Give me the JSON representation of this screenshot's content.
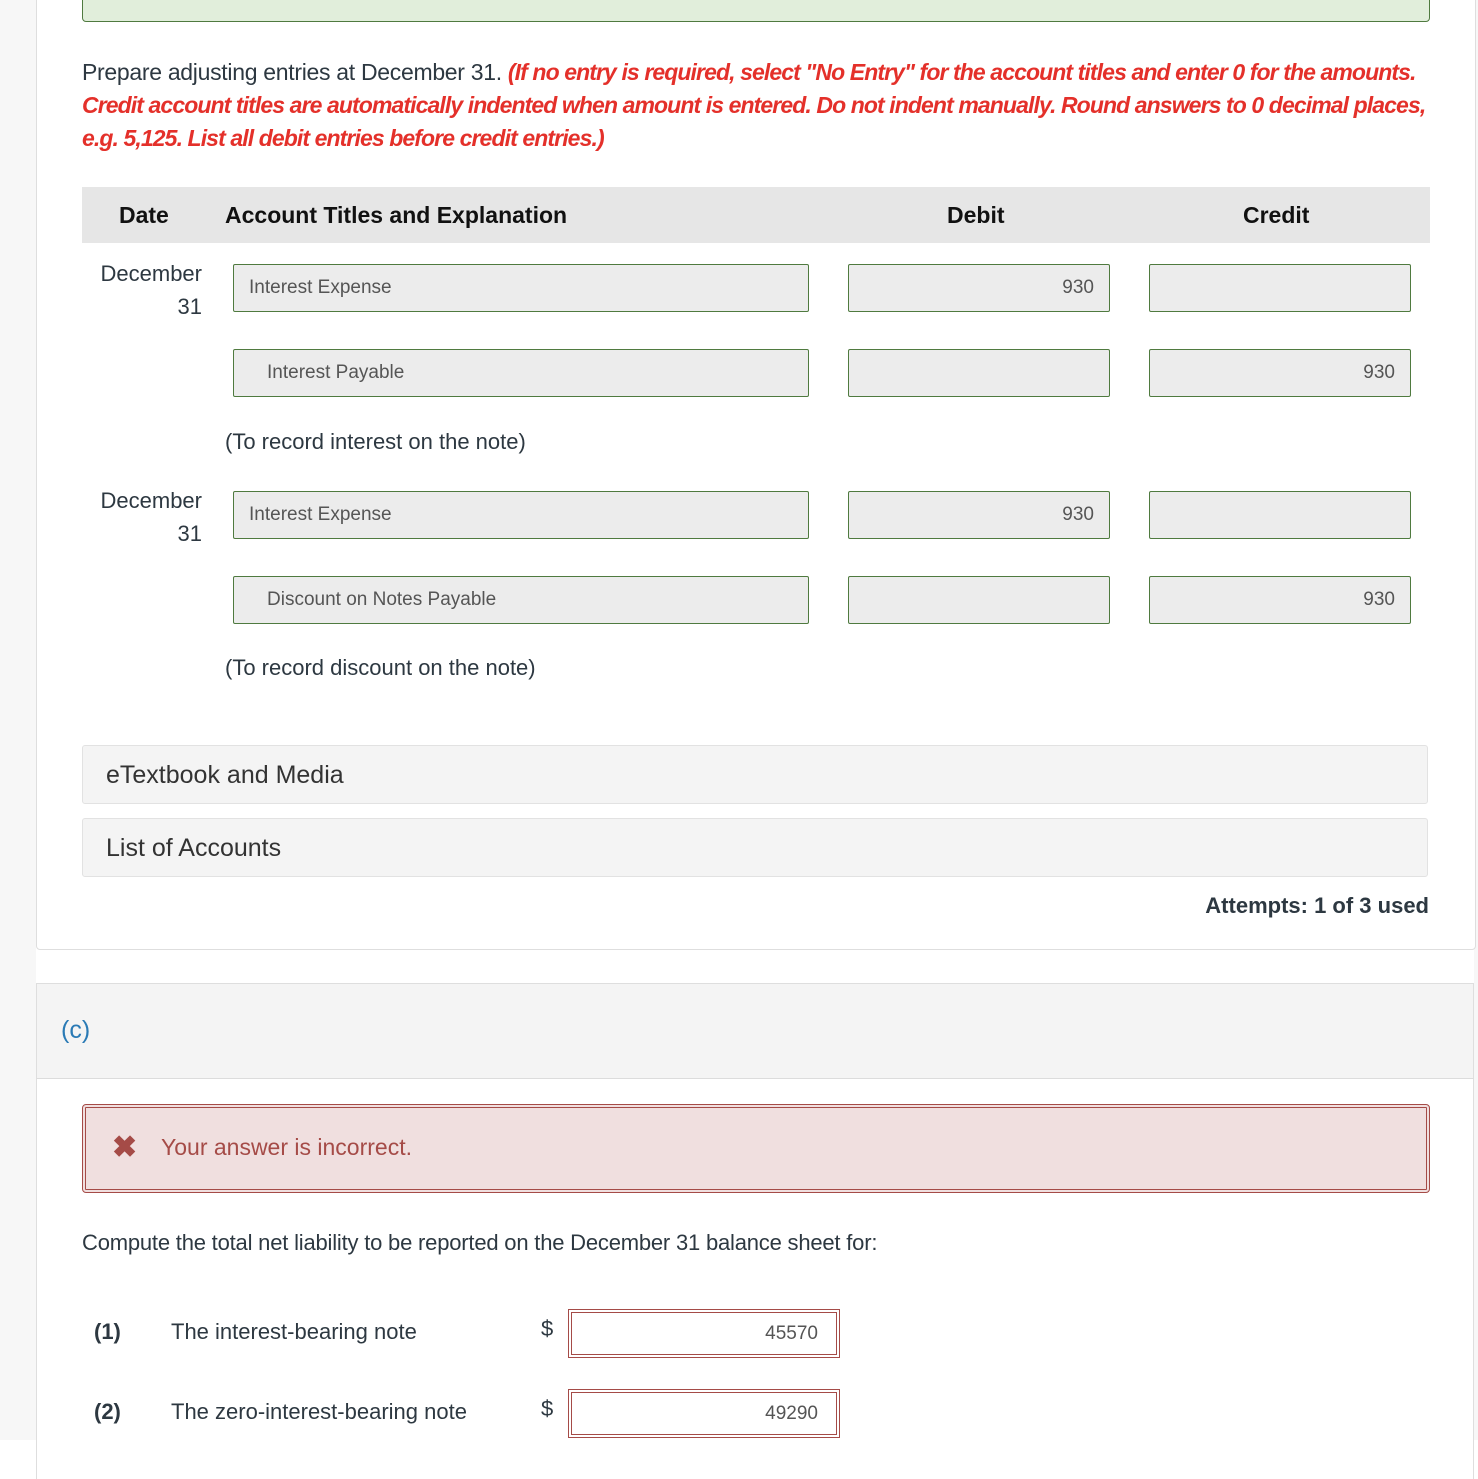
{
  "instructions": {
    "lead": "Prepare adjusting entries at December 31.",
    "note": "(If no entry is required, select \"No Entry\" for the account titles and enter 0 for the amounts. Credit account titles are automatically indented when amount is entered. Do not indent manually. Round answers to 0 decimal places, e.g. 5,125. List all debit entries before credit entries.)"
  },
  "table": {
    "headers": {
      "date": "Date",
      "account": "Account Titles and Explanation",
      "debit": "Debit",
      "credit": "Credit"
    },
    "entries": [
      {
        "date_line1": "December",
        "date_line2": "31",
        "rows": [
          {
            "account": "Interest Expense",
            "debit": "930",
            "credit": ""
          },
          {
            "account": "Interest Payable",
            "debit": "",
            "credit": "930"
          }
        ],
        "explanation": "(To record interest on the note)"
      },
      {
        "date_line1": "December",
        "date_line2": "31",
        "rows": [
          {
            "account": "Interest Expense",
            "debit": "930",
            "credit": ""
          },
          {
            "account": "Discount on Notes Payable",
            "debit": "",
            "credit": "930"
          }
        ],
        "explanation": "(To record discount on the note)"
      }
    ]
  },
  "resources": {
    "etextbook": "eTextbook and Media",
    "accounts": "List of Accounts"
  },
  "attempts": "Attempts: 1 of 3 used",
  "part_c": {
    "label": "(c)",
    "feedback": "Your answer is incorrect.",
    "feedback_icon": "x-icon",
    "question": "Compute the total net liability to be reported on the December 31 balance sheet for:",
    "items": [
      {
        "num": "(1)",
        "label": "The interest-bearing note",
        "currency": "$",
        "value": "45570"
      },
      {
        "num": "(2)",
        "label": "The zero-interest-bearing note",
        "currency": "$",
        "value": "49290"
      }
    ]
  },
  "colors": {
    "instruction_red": "#e4302a",
    "error_border": "#a54b47",
    "error_bg": "#f0dfdf",
    "input_border_green": "#4f7a3f",
    "correct_bg": "#e1eedb",
    "part_label_blue": "#2a7ab5"
  }
}
